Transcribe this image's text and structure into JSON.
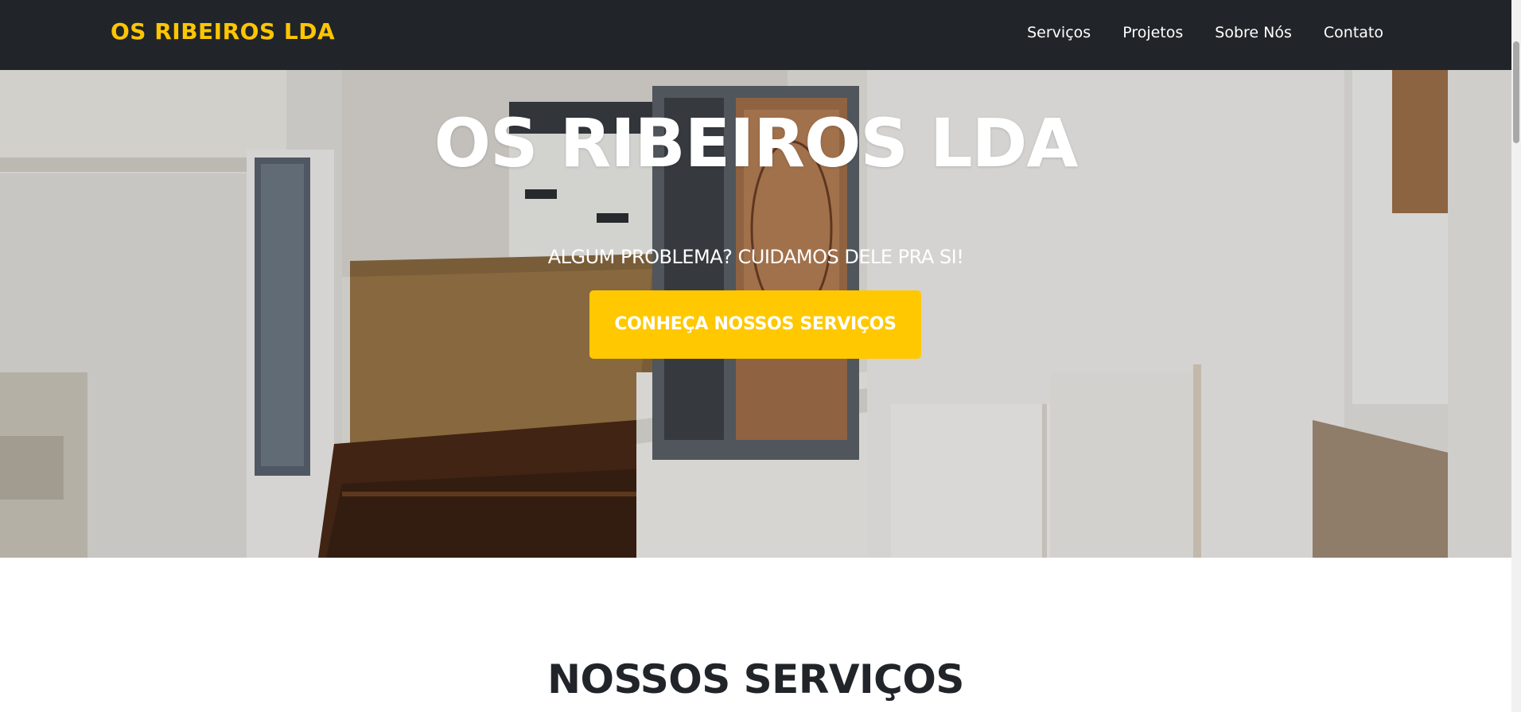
{
  "navbar": {
    "brand": "OS RIBEIROS LDA",
    "links": [
      "Serviços",
      "Projetos",
      "Sobre Nós",
      "Contato"
    ]
  },
  "hero": {
    "title": "OS RIBEIROS LDA",
    "subtitle": "ALGUM PROBLEMA? CUIDAMOS DELE PRA SI!",
    "button_label": "CONHEÇA NOSSOS SERVIÇOS"
  },
  "services": {
    "title": "NOSSOS SERVIÇOS"
  },
  "colors": {
    "navbar_bg": "#212529",
    "brand": "#fec503",
    "accent_button": "#ffc800",
    "heading_text": "#212529"
  }
}
